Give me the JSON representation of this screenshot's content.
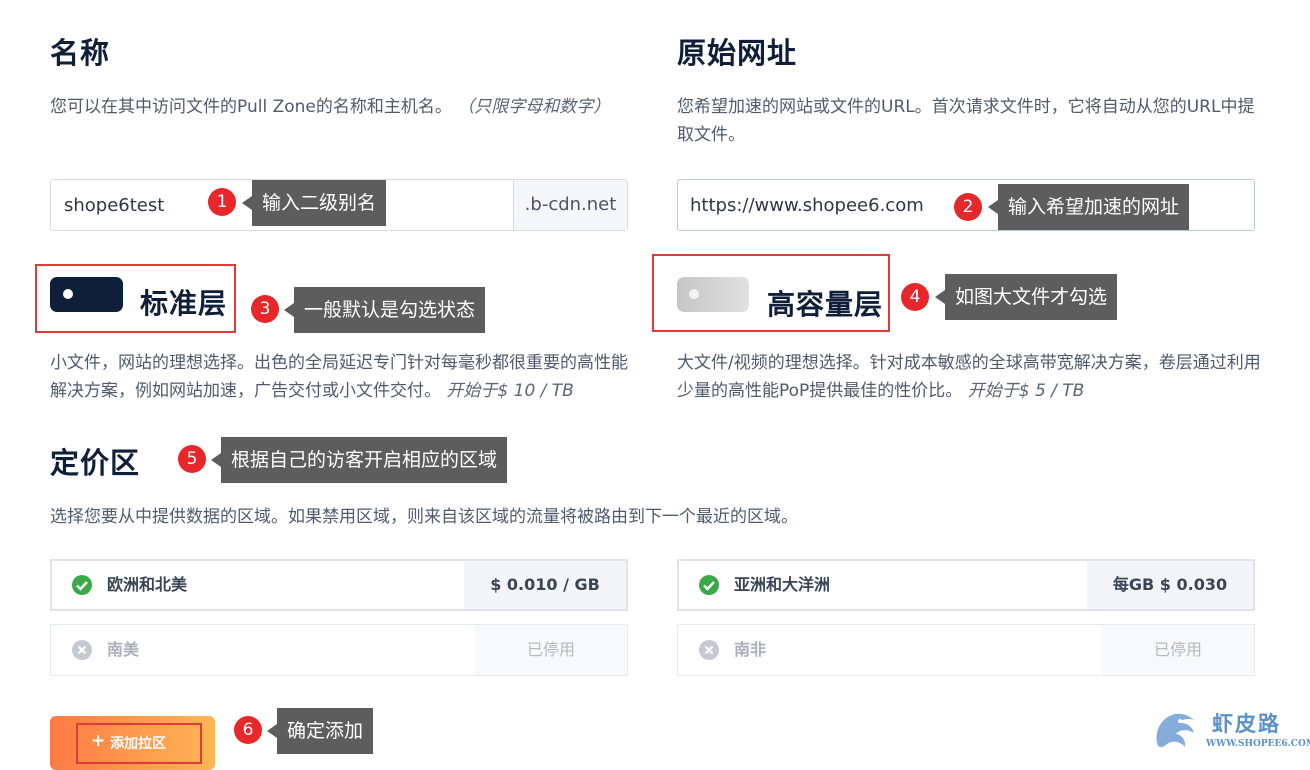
{
  "name_section": {
    "title": "名称",
    "description": "您可以在其中访问文件的Pull Zone的名称和主机名。",
    "description_note": "（只限字母和数字）",
    "input_value": "shope6test",
    "suffix": ".b-cdn.net"
  },
  "origin_section": {
    "title": "原始网址",
    "description": "您希望加速的网站或文件的URL。首次请求文件时，它将自动从您的URL中提取文件。",
    "input_value": "https://www.shopee6.com"
  },
  "tiers": {
    "standard": {
      "title": "标准层",
      "selected": true,
      "description": "小文件，网站的理想选择。出色的全局延迟专门针对每毫秒都很重要的高性能解决方案，例如网站加速，广告交付或小文件交付。",
      "price": "开始于$ 10 / TB"
    },
    "volume": {
      "title": "高容量层",
      "selected": false,
      "description": "大文件/视频的理想选择。针对成本敏感的全球高带宽解决方案，卷层通过利用少量的高性能PoP提供最佳的性价比。",
      "price": "开始于$ 5 / TB"
    }
  },
  "pricing_zone": {
    "title": "定价区",
    "description": "选择您要从中提供数据的区域。如果禁用区域，则来自该区域的流量将被路由到下一个最近的区域。",
    "regions": [
      {
        "name": "欧洲和北美",
        "price": "$ 0.010 / GB",
        "enabled": true
      },
      {
        "name": "亚洲和大洋洲",
        "price": "每GB $ 0.030",
        "enabled": true
      },
      {
        "name": "南美",
        "price": "已停用",
        "enabled": false
      },
      {
        "name": "南非",
        "price": "已停用",
        "enabled": false
      }
    ]
  },
  "add_button": {
    "label": "添加拉区",
    "icon": "plus-icon"
  },
  "annotations": [
    {
      "num": "1",
      "text": "输入二级别名"
    },
    {
      "num": "2",
      "text": "输入希望加速的网址"
    },
    {
      "num": "3",
      "text": "一般默认是勾选状态"
    },
    {
      "num": "4",
      "text": "如图大文件才勾选"
    },
    {
      "num": "5",
      "text": "根据自己的访客开启相应的区域"
    },
    {
      "num": "6",
      "text": "确定添加"
    }
  ],
  "watermark": {
    "name": "虾皮路",
    "url": "WWW.SHOPEE6.COM"
  },
  "colors": {
    "toggle_on": "#0f1f3a",
    "toggle_off": "#d2d2d2",
    "check_green": "#3aa94a",
    "badge_red": "#e8272a",
    "button_gradient_start": "#ff7a44",
    "button_gradient_end": "#ffb655"
  }
}
